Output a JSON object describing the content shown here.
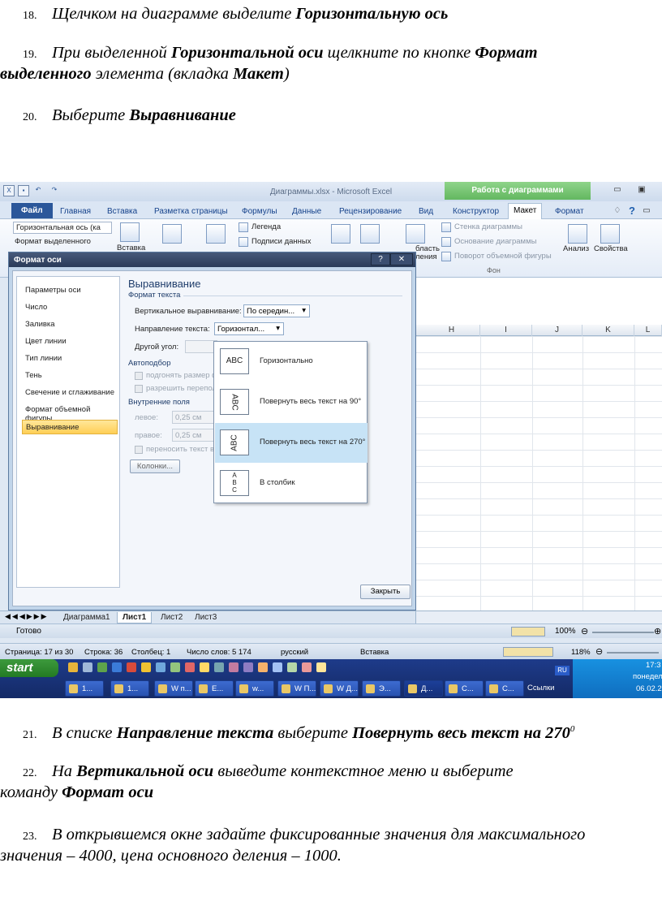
{
  "steps_top": [
    {
      "num": "18.",
      "parts": [
        {
          "t": "Щелчком на диаграмме выделите ",
          "b": false
        },
        {
          "t": "Горизонтальную ось",
          "b": true
        }
      ]
    },
    {
      "num": "19.",
      "parts": [
        {
          "t": "При выделенной ",
          "b": false
        },
        {
          "t": "Горизонтальной оси",
          "b": true
        },
        {
          "t": " щелкните по кнопке ",
          "b": false
        },
        {
          "t": "Формат",
          "b": true
        }
      ],
      "cont": [
        {
          "t": "выделенного",
          "b": true
        },
        {
          "t": " элемента (вкладка ",
          "b": false
        },
        {
          "t": "Макет",
          "b": true
        },
        {
          "t": ")",
          "b": false
        }
      ]
    },
    {
      "num": "20.",
      "parts": [
        {
          "t": "Выберите ",
          "b": false
        },
        {
          "t": "Выравнивание",
          "b": true
        }
      ]
    }
  ],
  "steps_bottom": [
    {
      "num": "21.",
      "parts": [
        {
          "t": "В списке ",
          "b": false
        },
        {
          "t": "Направление текста",
          "b": true
        },
        {
          "t": " выберите ",
          "b": false
        },
        {
          "t": "Повернуть весь текст на 270",
          "b": true
        },
        {
          "t": "0",
          "b": false,
          "sup": true
        }
      ]
    },
    {
      "num": "22.",
      "parts": [
        {
          "t": "На ",
          "b": false
        },
        {
          "t": "Вертикальной оси",
          "b": true
        },
        {
          "t": " выведите контекстное меню и выберите",
          "b": false
        }
      ],
      "cont": [
        {
          "t": "команду ",
          "b": false
        },
        {
          "t": "Формат оси",
          "b": true
        }
      ]
    },
    {
      "num": "23.",
      "parts": [
        {
          "t": "В открывшемся окне задайте фиксированные значения для максимального",
          "b": false
        }
      ],
      "cont": [
        {
          "t": "значения – 4000, цена основного деления – 1000.",
          "b": false
        }
      ]
    }
  ],
  "excel": {
    "window_title": "Диаграммы.xlsx  -  Microsoft Excel",
    "context_group": "Работа с диаграммами",
    "tabs": [
      "Главная",
      "Вставка",
      "Разметка страницы",
      "Формулы",
      "Данные",
      "Рецензирование",
      "Вид"
    ],
    "file_tab": "Файл",
    "context_tabs": [
      "Конструктор",
      "Макет",
      "Формат"
    ],
    "active_tab": "Макет",
    "ribbon": {
      "element_select": "Горизонтальная ось (ка",
      "format_selection": "Формат выделенного",
      "insert_label": "Вставка",
      "legend": "Легенда",
      "data_labels": "Подписи данных",
      "area_label": "бласть",
      "area_label2": "ления",
      "chart_wall": "Стенка диаграммы",
      "chart_floor": "Основание диаграммы",
      "rotation": "Поворот объемной фигуры",
      "group_background": "Фон",
      "analysis": "Анализ",
      "properties": "Свойства"
    },
    "columns": [
      "H",
      "I",
      "J",
      "K",
      "L"
    ],
    "sheets": [
      "Диаграмма1",
      "Лист1",
      "Лист2",
      "Лист3"
    ],
    "active_sheet": "Лист1",
    "status_ready": "Готово",
    "zoom": "100%"
  },
  "dialog": {
    "title": "Формат оси",
    "help": "?",
    "close_x": "✕",
    "nav": [
      "Параметры оси",
      "Число",
      "Заливка",
      "Цвет линии",
      "Тип линии",
      "Тень",
      "Свечение и сглаживание",
      "Формат объемной фигуры",
      "Выравнивание"
    ],
    "selected_nav": "Выравнивание",
    "heading": "Выравнивание",
    "section_text": "Формат текста",
    "valign_label": "Вертикальное выравнивание:",
    "valign_value": "По середин...",
    "direction_label": "Направление текста:",
    "direction_value": "Горизонтал...",
    "angle_label": "Другой угол:",
    "section_autofit": "Автоподбор",
    "autofit1": "подгонять размер ф",
    "autofit2": "разрешить перепол",
    "section_margins": "Внутренние поля",
    "left_label": "левое:",
    "left_value": "0,25 см",
    "right_label": "правое:",
    "right_value": "0,25 см",
    "wrap_label": "переносить текст в",
    "columns_btn": "Колонки...",
    "close_btn": "Закрыть",
    "popup": [
      {
        "icon": "ABC",
        "label": "Горизонтально"
      },
      {
        "icon": "ABC",
        "label": "Повернуть весь текст на 90°"
      },
      {
        "icon": "ABC",
        "label": "Повернуть весь текст на 270°"
      },
      {
        "icon": "A B C",
        "label": "В столбик"
      }
    ]
  },
  "word_status": {
    "page": "Страница: 17 из 30",
    "line": "Строка: 36",
    "column": "Столбец: 1",
    "words": "Число слов: 5 174",
    "lang": "русский",
    "mode": "Вставка",
    "zoom": "118%"
  },
  "taskbar": {
    "start": "start",
    "buttons": [
      "1...",
      "1...",
      "W п...",
      "Е...",
      "w...",
      "W П...",
      "W Д...",
      "Э...",
      "Д...",
      "С...",
      "С..."
    ],
    "links": "Ссылки",
    "lang": "RU",
    "time": "17:3",
    "day": "понедел",
    "date": "06.02.2"
  }
}
